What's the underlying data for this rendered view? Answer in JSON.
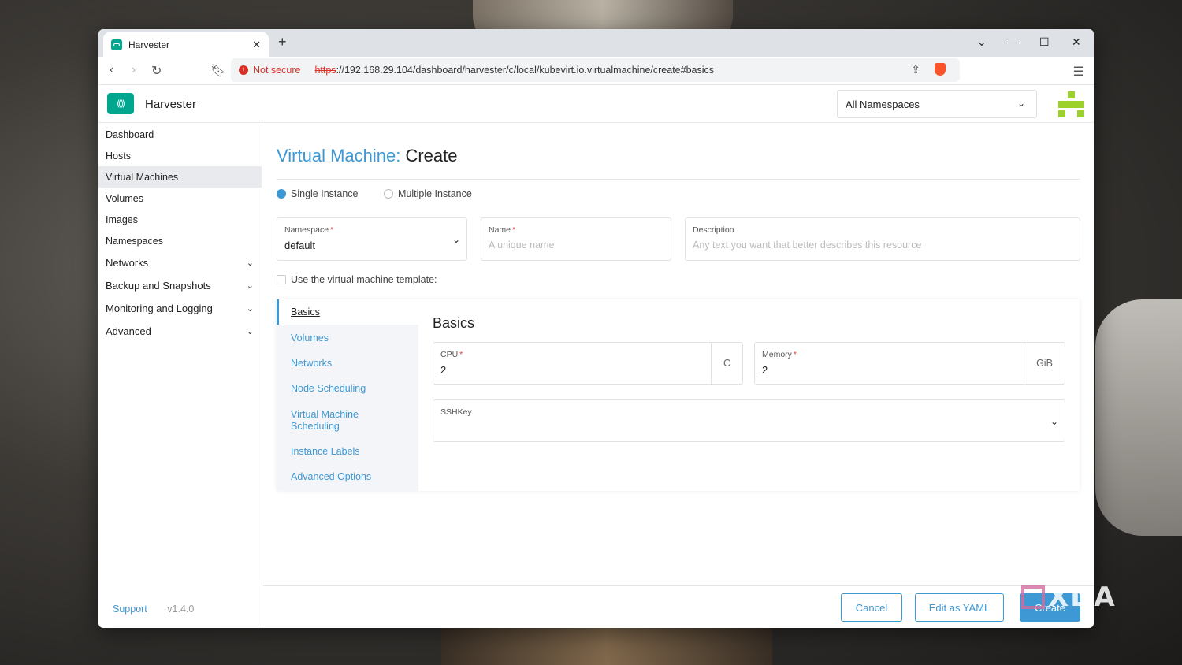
{
  "browser": {
    "tab_title": "Harvester",
    "security_label": "Not secure",
    "url_scheme": "https",
    "url_rest": "://192.168.29.104/dashboard/harvester/c/local/kubevirt.io.virtualmachine/create#basics"
  },
  "app": {
    "title": "Harvester",
    "namespace_select": "All Namespaces"
  },
  "sidebar": {
    "items": [
      "Dashboard",
      "Hosts",
      "Virtual Machines",
      "Volumes",
      "Images",
      "Namespaces"
    ],
    "groups": [
      "Networks",
      "Backup and Snapshots",
      "Monitoring and Logging",
      "Advanced"
    ],
    "support": "Support",
    "version": "v1.4.0"
  },
  "page": {
    "crumb": "Virtual Machine:",
    "action": "Create",
    "radio_single": "Single Instance",
    "radio_multiple": "Multiple Instance",
    "namespace_label": "Namespace",
    "namespace_value": "default",
    "name_label": "Name",
    "name_placeholder": "A unique name",
    "description_label": "Description",
    "description_placeholder": "Any text you want that better describes this resource",
    "template_check": "Use the virtual machine template:"
  },
  "tabs": [
    "Basics",
    "Volumes",
    "Networks",
    "Node Scheduling",
    "Virtual Machine Scheduling",
    "Instance Labels",
    "Advanced Options"
  ],
  "basics": {
    "heading": "Basics",
    "cpu_label": "CPU",
    "cpu_value": "2",
    "cpu_unit": "C",
    "memory_label": "Memory",
    "memory_value": "2",
    "memory_unit": "GiB",
    "sshkey_label": "SSHKey"
  },
  "footer": {
    "cancel": "Cancel",
    "edit_yaml": "Edit as YAML",
    "create": "Create"
  },
  "watermark": "XDA",
  "colors": {
    "accent": "#3d98d3",
    "brand": "#00a78e",
    "required": "#e04040"
  }
}
